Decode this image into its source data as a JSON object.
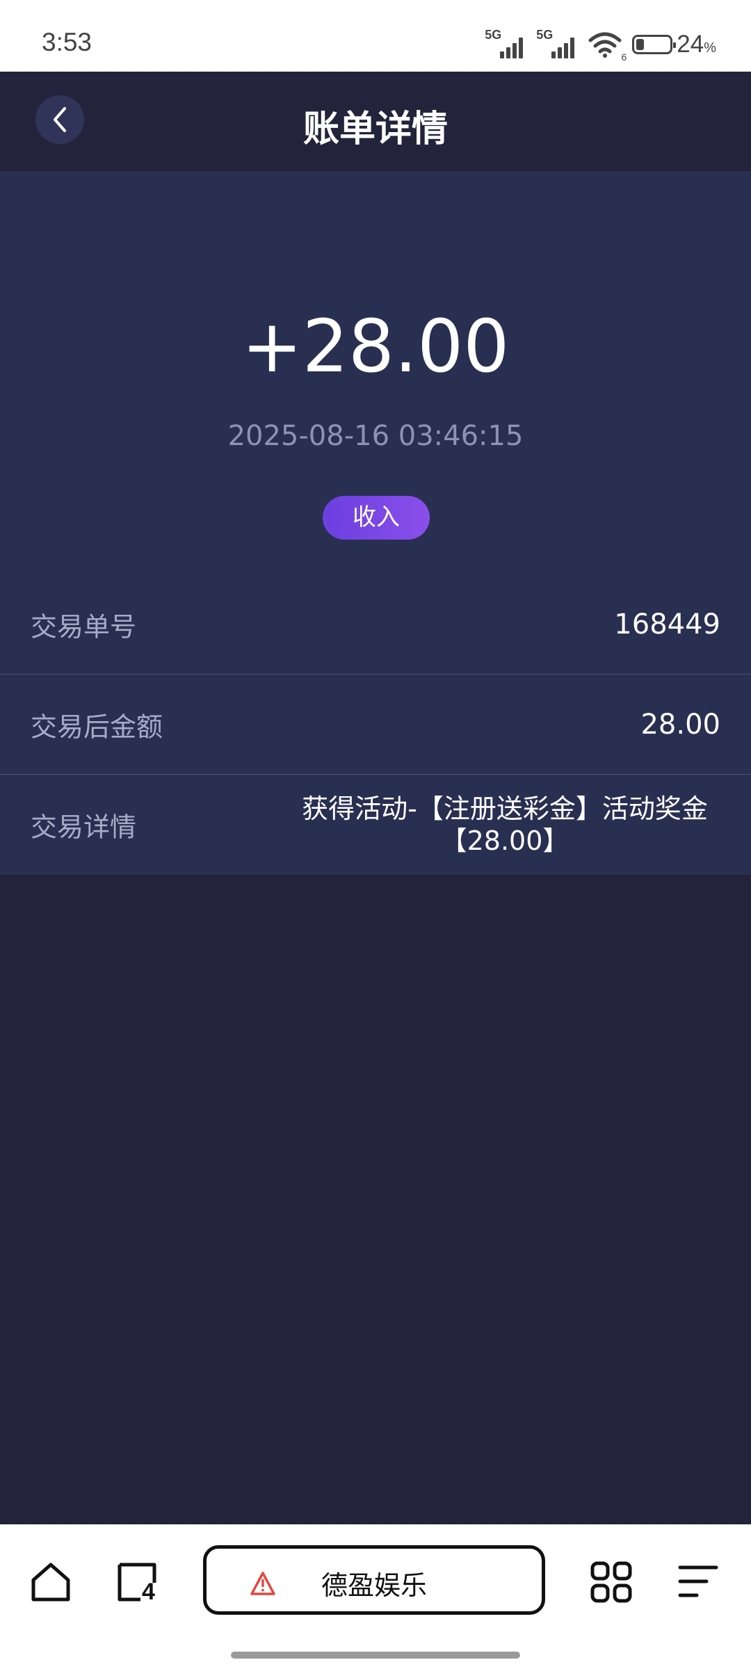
{
  "status_bar": {
    "time": "3:53",
    "signal_1_label": "5G",
    "signal_2_label": "5G",
    "wifi_badge": "6",
    "battery_percent": "24",
    "battery_unit": "%",
    "battery_level": 0.24,
    "icons": [
      "signal-icon",
      "wifi-icon",
      "battery-icon"
    ]
  },
  "header": {
    "title": "账单详情",
    "back_icon": "chevron-left-icon"
  },
  "summary": {
    "amount": "+28.00",
    "datetime": "2025-08-16 03:46:15",
    "type_label": "收入"
  },
  "details": [
    {
      "label": "交易单号",
      "value": "168449"
    },
    {
      "label": "交易后金额",
      "value": "28.00"
    },
    {
      "label": "交易详情",
      "value": "获得活动-【注册送彩金】活动奖金【28.00】"
    }
  ],
  "browser_bar": {
    "site_name": "德盈娱乐",
    "tab_count": "4",
    "icons": [
      "home-icon",
      "tabs-icon",
      "warning-icon",
      "apps-icon",
      "menu-icon"
    ]
  },
  "colors": {
    "background": "#23233b",
    "card": "#292f51",
    "accent": "#7a47e6",
    "muted_text": "#8d93b3"
  }
}
